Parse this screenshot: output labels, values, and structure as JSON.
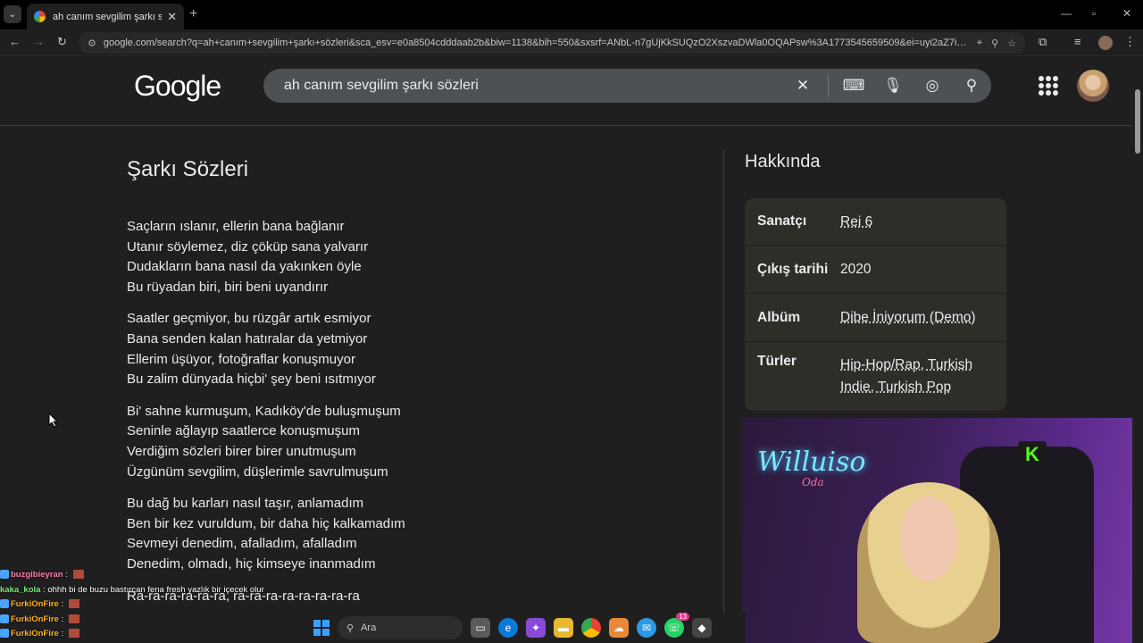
{
  "browser": {
    "tab_title": "ah canım sevgilim şarkı sözleri",
    "url": "google.com/search?q=ah+canım+sevgilim+şarkı+sözleri&sca_esv=e0a8504cdddaab2b&biw=1138&bih=550&sxsrf=ANbL-n7gUjKkSUQzO2XszvaDWla0OQAPsw%3A1773545659509&ei=uyi2aZ7iHpeGxc..."
  },
  "google": {
    "logo": "Google",
    "query": "ah canım sevgilim şarkı sözleri"
  },
  "lyrics": {
    "heading": "Şarkı Sözleri",
    "stanzas": [
      [
        "Saçların ıslanır, ellerin bana bağlanır",
        "Utanır söylemez, diz çöküp sana yalvarır",
        "Dudakların bana nasıl da yakınken öyle",
        "Bu rüyadan biri, biri beni uyandırır"
      ],
      [
        "Saatler geçmiyor, bu rüzgâr artık esmiyor",
        "Bana senden kalan hatıralar da yetmiyor",
        "Ellerim üşüyor, fotoğraflar konuşmuyor",
        "Bu zalim dünyada hiçbi' şey beni ısıtmıyor"
      ],
      [
        "Bi' sahne kurmuşum, Kadıköy'de buluşmuşum",
        "Seninle ağlayıp saatlerce konuşmuşum",
        "Verdiğim sözleri birer birer unutmuşum",
        "Üzgünüm sevgilim, düşlerimle savrulmuşum"
      ],
      [
        "Bu dağ bu karları nasıl taşır, anlamadım",
        "Ben bir kez vuruldum, bir daha hiç kalkamadım",
        "Sevmeyi denedim, afalladım, afalladım",
        "Denedim, olmadı, hiç kimseye inanmadım"
      ],
      [
        "Ra-ra-ra-ra-ra-ra, ra-ra-ra-ra-ra-ra-ra-ra"
      ]
    ]
  },
  "about": {
    "heading": "Hakkında",
    "rows": [
      {
        "key": "Sanatçı",
        "value": "Rei 6"
      },
      {
        "key": "Çıkış tarihi",
        "value": "2020"
      },
      {
        "key": "Albüm",
        "value": "Dibe İniyorum (Demo)"
      },
      {
        "key": "Türler",
        "value": "Hip-Hop/Rap, Turkish Indie, Turkish Pop"
      }
    ]
  },
  "stream": {
    "neon_sign": "Willuiso",
    "neon_sub": "Oda",
    "kick_logo": "K"
  },
  "chat": [
    {
      "user": "buzgibieyran",
      "color": "#ff7ab0",
      "msg": ""
    },
    {
      "user": "kaka_kola",
      "color": "#7ae87a",
      "msg": "ohhh bi de buzu bastırcan fena fresh yazlık bir içecek olur"
    },
    {
      "user": "FurkiOnFire",
      "color": "#ffb020",
      "msg": ""
    },
    {
      "user": "FurkiOnFire",
      "color": "#ffb020",
      "msg": ""
    },
    {
      "user": "FurkiOnFire",
      "color": "#ffb020",
      "msg": ""
    }
  ],
  "taskbar": {
    "search_placeholder": "Ara",
    "whatsapp_badge": "13"
  }
}
